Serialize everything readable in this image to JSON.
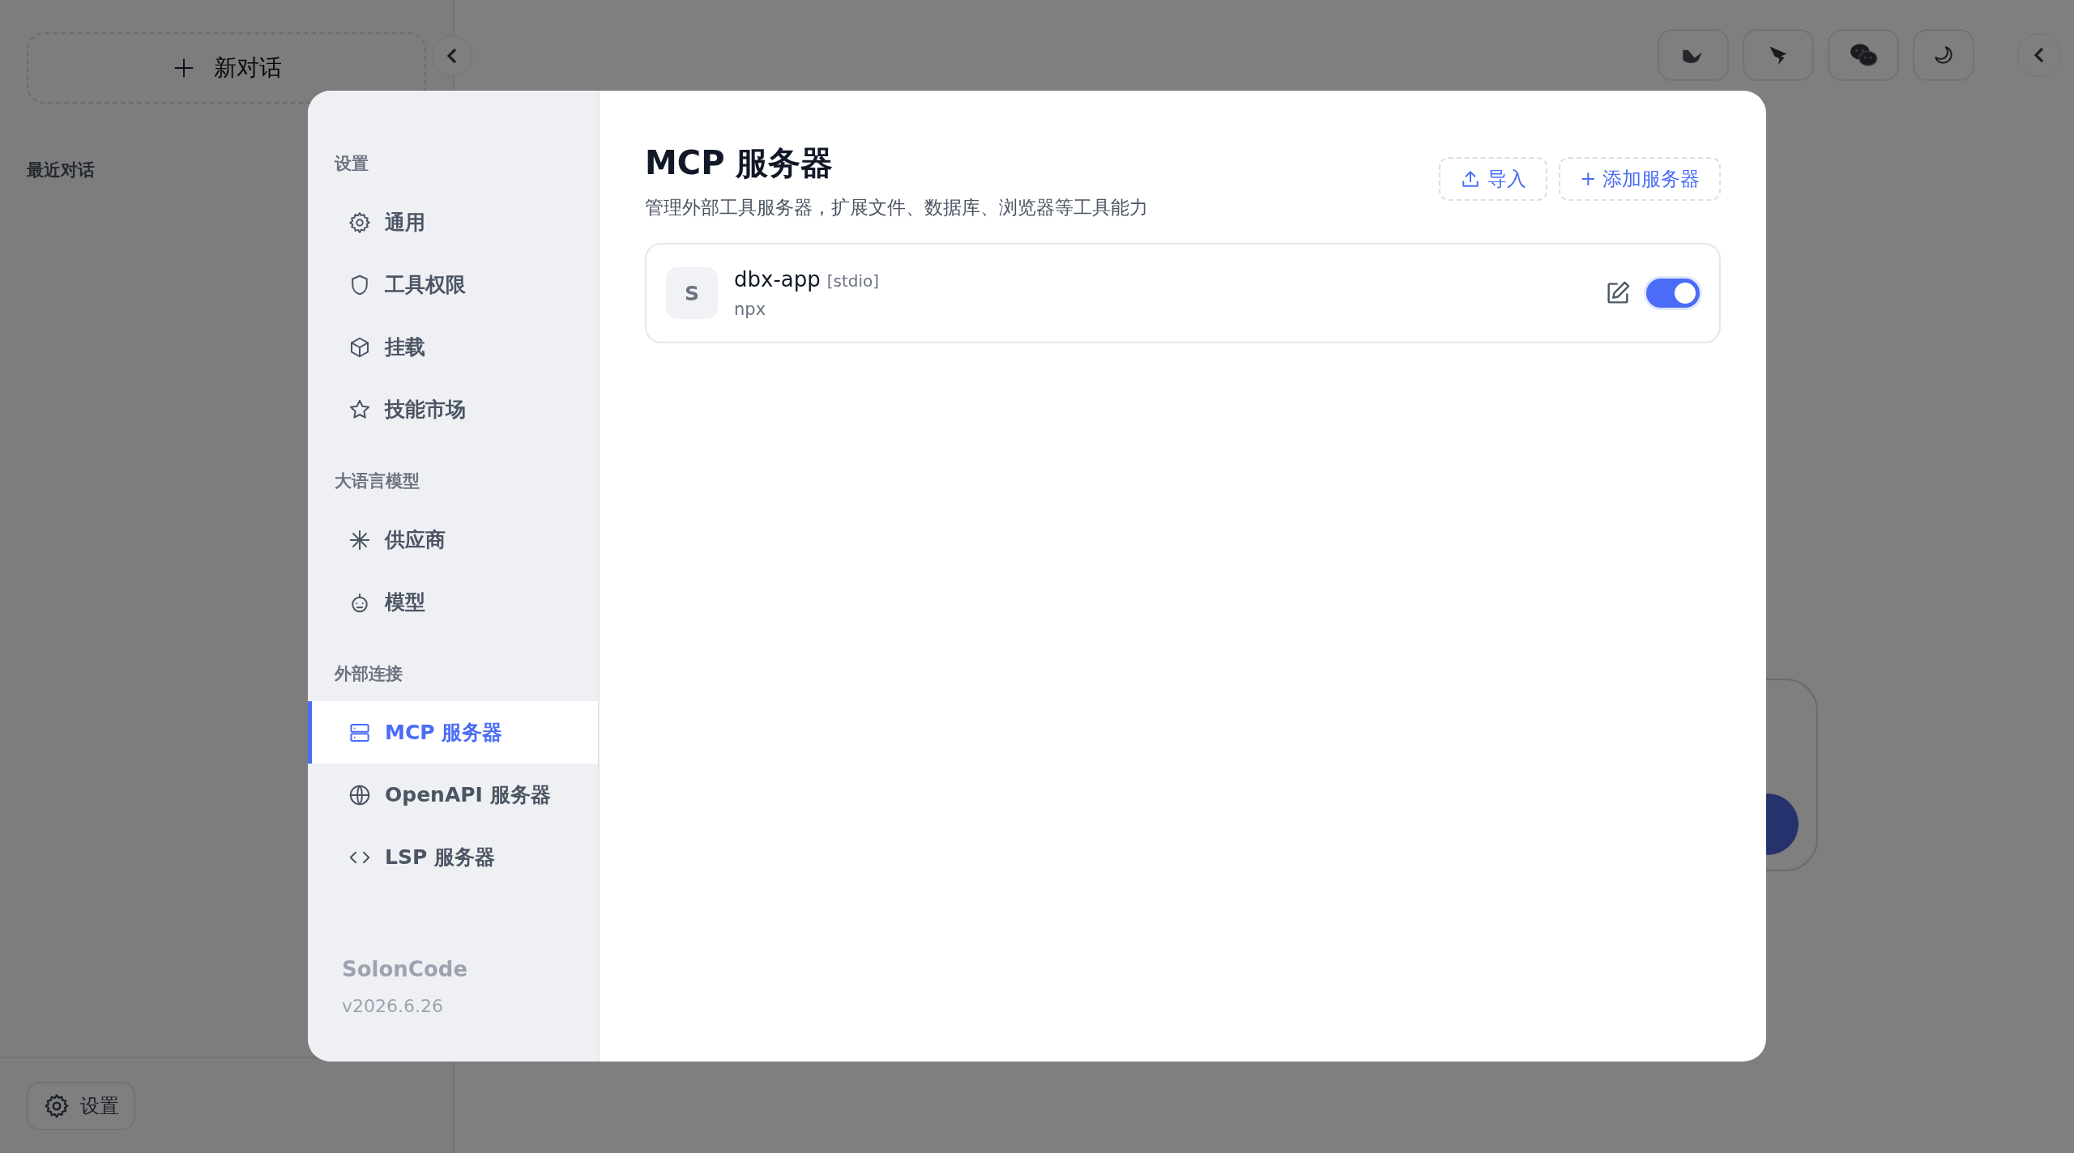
{
  "app": {
    "new_chat_button": "新对话",
    "recent_heading": "最近对话",
    "settings_button": "设置"
  },
  "settings_dialog": {
    "nav": [
      {
        "heading": "设置",
        "items": [
          {
            "label": "通用",
            "selected": false
          },
          {
            "label": "工具权限",
            "selected": false
          },
          {
            "label": "挂载",
            "selected": false
          },
          {
            "label": "技能市场",
            "selected": false
          }
        ]
      },
      {
        "heading": "大语言模型",
        "items": [
          {
            "label": "供应商",
            "selected": false
          },
          {
            "label": "模型",
            "selected": false
          }
        ]
      },
      {
        "heading": "外部连接",
        "items": [
          {
            "label": "MCP 服务器",
            "selected": true
          },
          {
            "label": "OpenAPI 服务器",
            "selected": false
          },
          {
            "label": "LSP 服务器",
            "selected": false
          }
        ]
      }
    ],
    "brand": "SolonCode",
    "version": "v2026.6.26",
    "title": "MCP 服务器",
    "subtitle": "管理外部工具服务器，扩展文件、数据库、浏览器等工具能力",
    "import_button": "导入",
    "add_button": "+ 添加服务器",
    "servers": [
      {
        "avatar": "S",
        "name": "dbx-app",
        "transport": "[stdio]",
        "command": "npx",
        "on": true
      }
    ]
  }
}
